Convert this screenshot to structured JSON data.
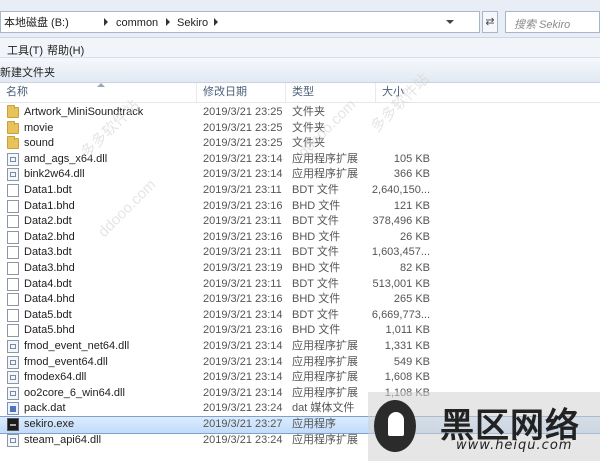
{
  "address": {
    "segments": [
      "本地磁盘 (B:)",
      "common",
      "Sekiro"
    ],
    "refresh_glyph": "⇄",
    "search_placeholder": "搜索 Sekiro"
  },
  "menu": [
    "工具(T)",
    "帮助(H)"
  ],
  "toolbar": {
    "new_folder": "新建文件夹"
  },
  "columns": {
    "name": "名称",
    "modified": "修改日期",
    "type": "类型",
    "size": "大小"
  },
  "files": [
    {
      "name": "Artwork_MiniSoundtrack",
      "modified": "2019/3/21 23:25",
      "type": "文件夹",
      "size": "",
      "icon": "folder-icon"
    },
    {
      "name": "movie",
      "modified": "2019/3/21 23:25",
      "type": "文件夹",
      "size": "",
      "icon": "folder-icon"
    },
    {
      "name": "sound",
      "modified": "2019/3/21 23:25",
      "type": "文件夹",
      "size": "",
      "icon": "folder-icon"
    },
    {
      "name": "amd_ags_x64.dll",
      "modified": "2019/3/21 23:14",
      "type": "应用程序扩展",
      "size": "105 KB",
      "icon": "dll-icon"
    },
    {
      "name": "bink2w64.dll",
      "modified": "2019/3/21 23:14",
      "type": "应用程序扩展",
      "size": "366 KB",
      "icon": "dll-icon"
    },
    {
      "name": "Data1.bdt",
      "modified": "2019/3/21 23:11",
      "type": "BDT 文件",
      "size": "2,640,150...",
      "icon": "file-icon"
    },
    {
      "name": "Data1.bhd",
      "modified": "2019/3/21 23:16",
      "type": "BHD 文件",
      "size": "121 KB",
      "icon": "file-icon"
    },
    {
      "name": "Data2.bdt",
      "modified": "2019/3/21 23:11",
      "type": "BDT 文件",
      "size": "378,496 KB",
      "icon": "file-icon"
    },
    {
      "name": "Data2.bhd",
      "modified": "2019/3/21 23:16",
      "type": "BHD 文件",
      "size": "26 KB",
      "icon": "file-icon"
    },
    {
      "name": "Data3.bdt",
      "modified": "2019/3/21 23:11",
      "type": "BDT 文件",
      "size": "1,603,457...",
      "icon": "file-icon"
    },
    {
      "name": "Data3.bhd",
      "modified": "2019/3/21 23:19",
      "type": "BHD 文件",
      "size": "82 KB",
      "icon": "file-icon"
    },
    {
      "name": "Data4.bdt",
      "modified": "2019/3/21 23:11",
      "type": "BDT 文件",
      "size": "513,001 KB",
      "icon": "file-icon"
    },
    {
      "name": "Data4.bhd",
      "modified": "2019/3/21 23:16",
      "type": "BHD 文件",
      "size": "265 KB",
      "icon": "file-icon"
    },
    {
      "name": "Data5.bdt",
      "modified": "2019/3/21 23:14",
      "type": "BDT 文件",
      "size": "6,669,773...",
      "icon": "file-icon"
    },
    {
      "name": "Data5.bhd",
      "modified": "2019/3/21 23:16",
      "type": "BHD 文件",
      "size": "1,011 KB",
      "icon": "file-icon"
    },
    {
      "name": "fmod_event_net64.dll",
      "modified": "2019/3/21 23:14",
      "type": "应用程序扩展",
      "size": "1,331 KB",
      "icon": "dll-icon"
    },
    {
      "name": "fmod_event64.dll",
      "modified": "2019/3/21 23:14",
      "type": "应用程序扩展",
      "size": "549 KB",
      "icon": "dll-icon"
    },
    {
      "name": "fmodex64.dll",
      "modified": "2019/3/21 23:14",
      "type": "应用程序扩展",
      "size": "1,608 KB",
      "icon": "dll-icon"
    },
    {
      "name": "oo2core_6_win64.dll",
      "modified": "2019/3/21 23:14",
      "type": "应用程序扩展",
      "size": "1,108 KB",
      "icon": "dll-icon"
    },
    {
      "name": "pack.dat",
      "modified": "2019/3/21 23:24",
      "type": "dat 媒体文件",
      "size": "",
      "icon": "pack-icon"
    },
    {
      "name": "sekiro.exe",
      "modified": "2019/3/21 23:27",
      "type": "应用程序",
      "size": "",
      "icon": "exe-icon",
      "selected": true
    },
    {
      "name": "steam_api64.dll",
      "modified": "2019/3/21 23:24",
      "type": "应用程序扩展",
      "size": "",
      "icon": "dll-icon"
    }
  ],
  "logo": {
    "chinese": "黑区网络",
    "url": "www.heiqu.com"
  },
  "watermark_text": "多多软件站"
}
